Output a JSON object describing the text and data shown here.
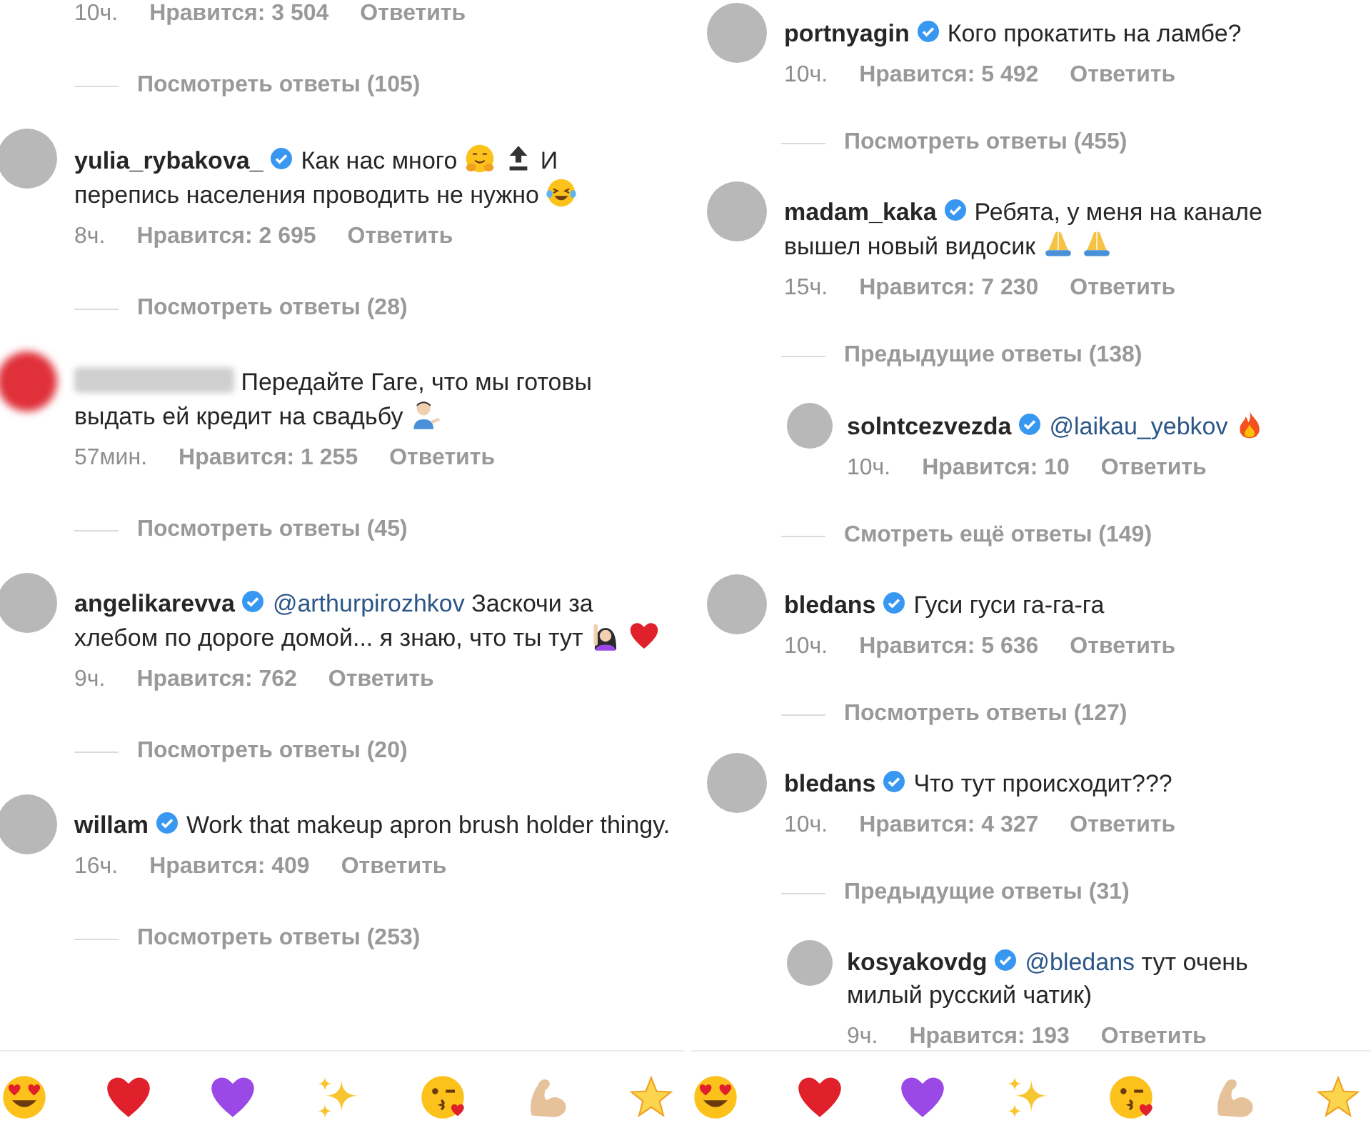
{
  "panels": [
    {
      "items": [
        {
          "kind": "meta",
          "time": "10ч.",
          "likes": "Нравится: 3 504",
          "reply": "Ответить"
        },
        {
          "kind": "link",
          "text": "Посмотреть ответы (105)"
        },
        {
          "kind": "comment",
          "user": "yulia_rybakova_",
          "verified": true,
          "body": [
            {
              "kind": "text",
              "text": "Как нас много"
            },
            {
              "kind": "hug"
            },
            {
              "kind": "top"
            },
            {
              "kind": "text",
              "text": "И"
            },
            {
              "kind": "text",
              "text": "перепись населения проводить не нужно"
            },
            {
              "kind": "laugh"
            }
          ],
          "time": "8ч.",
          "likes": "Нравится: 2 695",
          "reply": "Ответить"
        },
        {
          "kind": "link",
          "text": "Посмотреть ответы (28)"
        },
        {
          "kind": "comment",
          "username_blurred": true,
          "verified": false,
          "body": [
            {
              "kind": "text",
              "text": "Передайте Гаге, что мы готовы"
            },
            {
              "kind": "text",
              "text": "выдать ей кредит на свадьбу"
            },
            {
              "kind": "shrug"
            }
          ],
          "time": "57мин.",
          "likes": "Нравится: 1 255",
          "reply": "Ответить"
        },
        {
          "kind": "link",
          "text": "Посмотреть ответы (45)"
        },
        {
          "kind": "comment",
          "user": "angelikarevva",
          "verified": true,
          "body": [
            {
              "kind": "mention",
              "text": "@arthurpirozhkov"
            },
            {
              "kind": "text",
              "text": "Заскочи за"
            },
            {
              "kind": "text",
              "text": "хлебом по дороге домой... я знаю, что ты"
            },
            {
              "kind": "text",
              "text": "тут"
            },
            {
              "kind": "raise-hand"
            },
            {
              "kind": "heart"
            }
          ],
          "time": "9ч.",
          "likes": "Нравится: 762",
          "reply": "Ответить"
        },
        {
          "kind": "link",
          "text": "Посмотреть ответы (20)"
        },
        {
          "kind": "comment",
          "user": "willam",
          "verified": true,
          "body": [
            {
              "kind": "text",
              "text": "Work that makeup apron brush"
            },
            {
              "kind": "text",
              "text": "holder thingy."
            }
          ],
          "time": "16ч.",
          "likes": "Нравится: 409",
          "reply": "Ответить"
        },
        {
          "kind": "link",
          "text": "Посмотреть ответы (253)"
        }
      ],
      "emoji_bar": [
        {
          "kind": "heart-eyes"
        },
        {
          "kind": "heart"
        },
        {
          "kind": "purple-heart"
        },
        {
          "kind": "sparkles"
        },
        {
          "kind": "kiss"
        },
        {
          "kind": "bicep"
        },
        {
          "kind": "star"
        }
      ]
    },
    {
      "items": [
        {
          "kind": "comment",
          "user": "portnyagin",
          "verified": true,
          "body": [
            {
              "kind": "text",
              "text": "Кого прокатить на ламбе?"
            }
          ],
          "time": "10ч.",
          "likes": "Нравится: 5 492",
          "reply": "Ответить"
        },
        {
          "kind": "link",
          "text": "Посмотреть ответы (455)"
        },
        {
          "kind": "comment",
          "user": "madam_kaka",
          "verified": true,
          "body": [
            {
              "kind": "text",
              "text": "Ребята, у меня на канале"
            },
            {
              "kind": "text",
              "text": "вышел новый видосик"
            },
            {
              "kind": "pray"
            },
            {
              "kind": "pray"
            }
          ],
          "time": "15ч.",
          "likes": "Нравится: 7 230",
          "reply": "Ответить",
          "children": [
            {
              "kind": "link",
              "text": "Предыдущие ответы (138)"
            },
            {
              "kind": "comment",
              "user": "solntcezvezda",
              "verified": true,
              "body": [
                {
                  "kind": "mention",
                  "text": "@laikau_yebkov"
                },
                {
                  "kind": "fire"
                }
              ],
              "time": "10ч.",
              "likes": "Нравится: 10",
              "reply": "Ответить"
            },
            {
              "kind": "link",
              "text": "Смотреть ещё ответы (149)"
            }
          ]
        },
        {
          "kind": "comment",
          "user": "bledans",
          "verified": true,
          "body": [
            {
              "kind": "text",
              "text": "Гуси гуси га-га-га"
            }
          ],
          "time": "10ч.",
          "likes": "Нравится: 5 636",
          "reply": "Ответить"
        },
        {
          "kind": "link",
          "text": "Посмотреть ответы (127)"
        },
        {
          "kind": "comment",
          "user": "bledans",
          "verified": true,
          "body": [
            {
              "kind": "text",
              "text": "Что тут происходит???"
            }
          ],
          "time": "10ч.",
          "likes": "Нравится: 4 327",
          "reply": "Ответить",
          "children": [
            {
              "kind": "link",
              "text": "Предыдущие ответы (31)"
            },
            {
              "kind": "comment",
              "user": "kosyakovdg",
              "verified": true,
              "body": [
                {
                  "kind": "mention",
                  "text": "@bledans"
                },
                {
                  "kind": "text",
                  "text": "тут очень"
                },
                {
                  "kind": "text",
                  "text": "милый русский чатик)"
                }
              ],
              "time": "9ч.",
              "likes": "Нравится: 193",
              "reply": "Ответить"
            }
          ]
        }
      ],
      "emoji_bar": [
        {
          "kind": "heart-eyes"
        },
        {
          "kind": "heart"
        },
        {
          "kind": "purple-heart"
        },
        {
          "kind": "sparkles"
        },
        {
          "kind": "kiss"
        },
        {
          "kind": "bicep"
        },
        {
          "kind": "star"
        }
      ]
    }
  ]
}
